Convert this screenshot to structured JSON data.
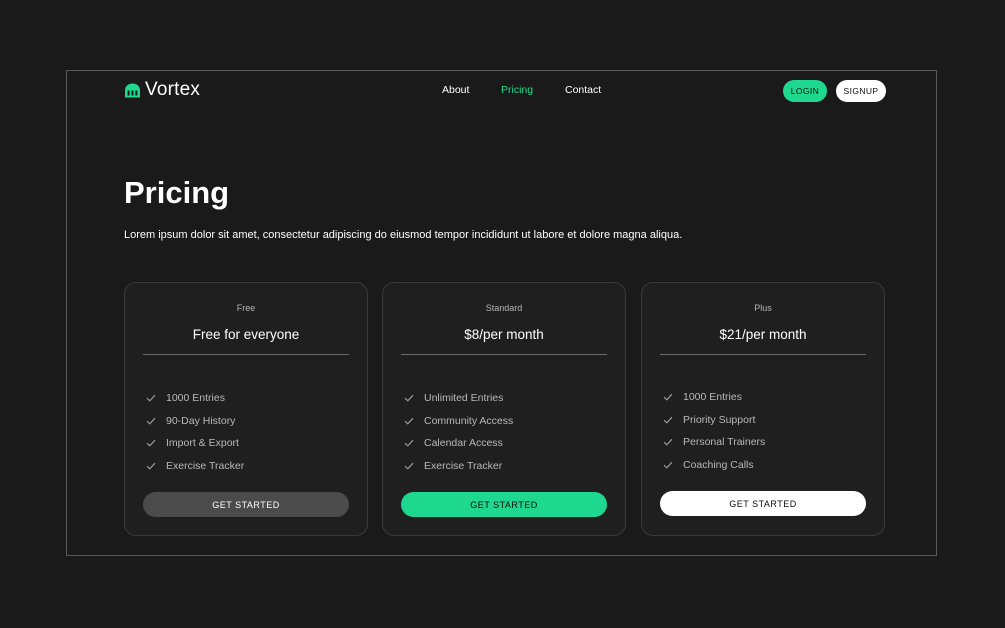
{
  "brand": {
    "name": "Vortex",
    "accent": "#1ed88f",
    "background": "#1a1a1a",
    "logo_icon": "vortex-logo-icon"
  },
  "nav": {
    "links": [
      {
        "label": "About",
        "active": false
      },
      {
        "label": "Pricing",
        "active": true
      },
      {
        "label": "Contact",
        "active": false
      }
    ],
    "login_label": "LOGIN",
    "signup_label": "SIGNUP"
  },
  "hero": {
    "title": "Pricing",
    "subtitle": "Lorem ipsum dolor sit amet, consectetur adipiscing do eiusmod tempor incididunt ut labore et dolore magna aliqua."
  },
  "plans": [
    {
      "name": "Free",
      "price": "Free for everyone",
      "features": [
        "1000 Entries",
        "90-Day History",
        "Import & Export",
        "Exercise Tracker"
      ],
      "cta_label": "GET STARTED",
      "cta_color": "#4b4b4b"
    },
    {
      "name": "Standard",
      "price": "$8/per month",
      "features": [
        "Unlimited Entries",
        "Community Access",
        "Calendar Access",
        "Exercise Tracker"
      ],
      "cta_label": "GET STARTED",
      "cta_color": "#1ed88f"
    },
    {
      "name": "Plus",
      "price": "$21/per month",
      "features": [
        "1000 Entries",
        "Priority Support",
        "Personal Trainers",
        "Coaching Calls"
      ],
      "cta_label": "GET STARTED",
      "cta_color": "#ffffff"
    }
  ],
  "icons": {
    "feature_check": "check-icon"
  }
}
